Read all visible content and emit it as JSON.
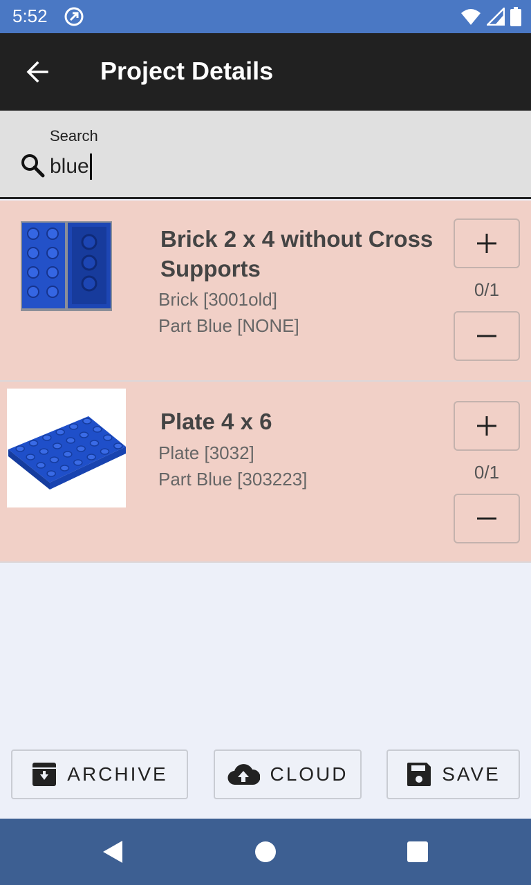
{
  "status_bar": {
    "time": "5:52"
  },
  "app_bar": {
    "title": "Project Details"
  },
  "search": {
    "label": "Search",
    "value": "blue"
  },
  "items": [
    {
      "title": "Brick 2 x 4 without Cross Supports",
      "line1": "Brick [3001old]",
      "line2": "Part Blue [NONE]",
      "count": "0/1"
    },
    {
      "title": "Plate 4 x 6",
      "line1": "Plate [3032]",
      "line2": "Part Blue [303223]",
      "count": "0/1"
    }
  ],
  "actions": {
    "archive": "ARCHIVE",
    "cloud": "CLOUD",
    "save": "SAVE"
  },
  "icons": [
    "arrow-left-icon",
    "search-icon",
    "plus-icon",
    "minus-icon",
    "archive-icon",
    "cloud-upload-icon",
    "save-icon",
    "back-triangle-icon",
    "home-circle-icon",
    "recents-square-icon"
  ],
  "colors": {
    "status_bar": "#4a78c4",
    "app_bar": "#212121",
    "item_background": "#f1d0c7",
    "nav_bar": "#3d5f92",
    "brick_blue": "#1f4fc9"
  }
}
